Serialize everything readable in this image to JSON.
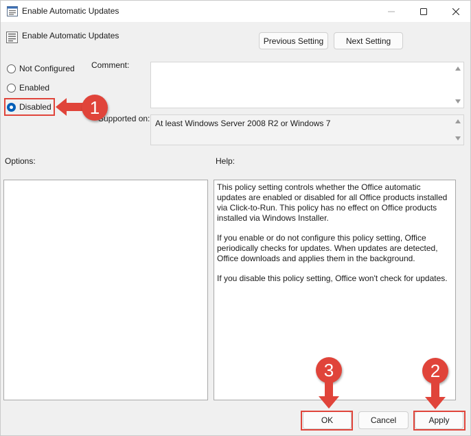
{
  "window": {
    "title": "Enable Automatic Updates",
    "icons": {
      "app": "policy-icon",
      "minimize": "minimize-icon",
      "maximize": "maximize-icon",
      "close": "close-icon"
    }
  },
  "header": {
    "setting_name": "Enable Automatic Updates",
    "icon": "policy-setting-icon"
  },
  "navigation": {
    "previous_label": "Previous Setting",
    "next_label": "Next Setting"
  },
  "state": {
    "options": [
      {
        "label": "Not Configured",
        "selected": false
      },
      {
        "label": "Enabled",
        "selected": false
      },
      {
        "label": "Disabled",
        "selected": true
      }
    ]
  },
  "comment": {
    "label": "Comment:",
    "value": ""
  },
  "supported": {
    "label": "Supported on:",
    "value": "At least Windows Server 2008 R2 or Windows 7"
  },
  "options_pane": {
    "label": "Options:"
  },
  "help": {
    "label": "Help:",
    "paragraphs": [
      "This policy setting controls whether the Office automatic updates are enabled or disabled for all Office products installed via Click-to-Run. This policy has no effect on Office products installed via Windows Installer.",
      "If you enable or do not configure this policy setting, Office periodically checks for updates. When updates are detected, Office downloads and applies them in the background.",
      "If you disable this policy setting, Office won't check for updates."
    ]
  },
  "footer": {
    "ok_label": "OK",
    "cancel_label": "Cancel",
    "apply_label": "Apply"
  },
  "annotations": {
    "color": "#e0443a",
    "step_disabled": "1",
    "step_apply": "2",
    "step_ok": "3"
  }
}
